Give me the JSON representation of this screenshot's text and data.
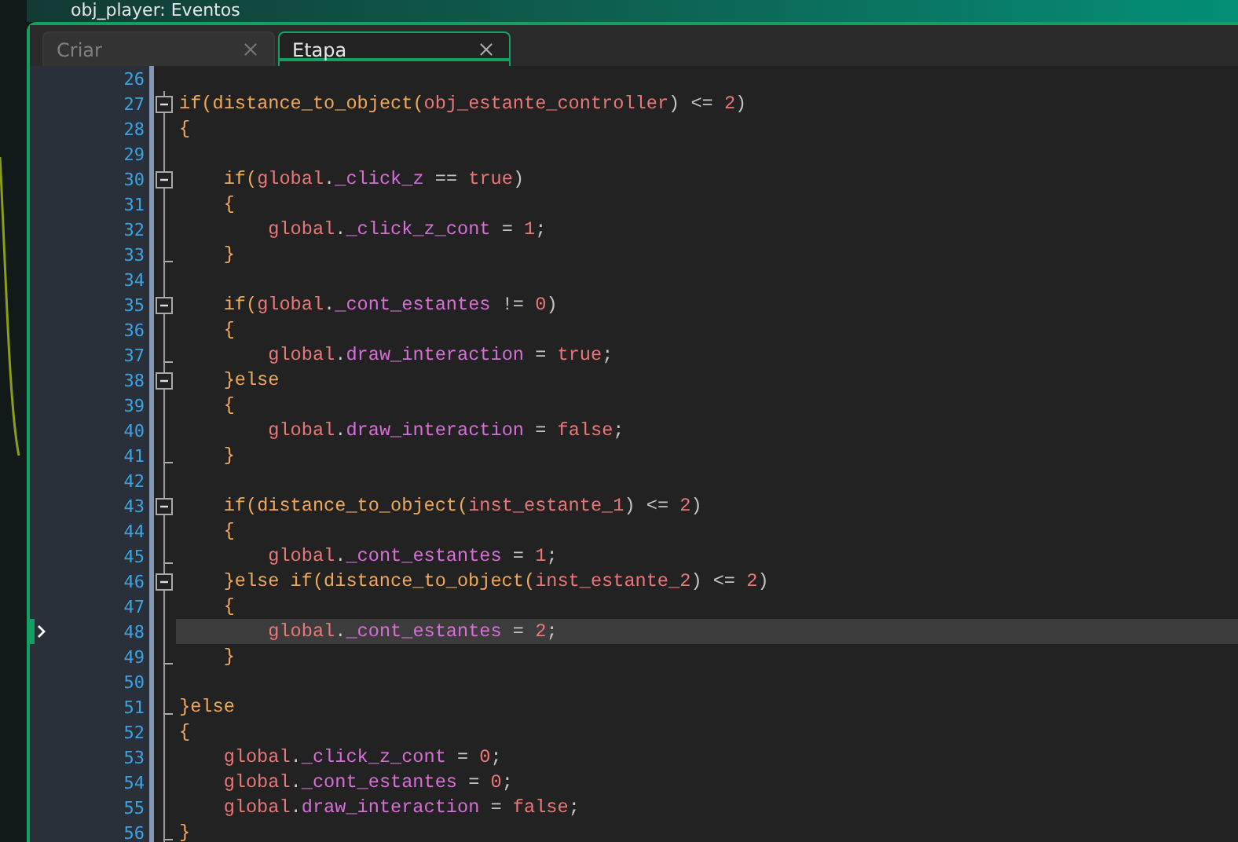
{
  "window": {
    "title": "obj_player: Eventos"
  },
  "tabs": [
    {
      "label": "Criar",
      "selected": false
    },
    {
      "label": "Etapa",
      "selected": true
    }
  ],
  "editor": {
    "lines": [
      {
        "number": "26",
        "kind": "plain",
        "current": false
      },
      {
        "number": "27",
        "kind": "fold_open",
        "current": false,
        "tokens": [
          {
            "kind": "kw",
            "text": "if("
          },
          {
            "kind": "fn",
            "text": "distance_to_object"
          },
          {
            "kind": "kw",
            "text": "("
          },
          {
            "kind": "res",
            "text": "obj_estante_controller"
          },
          {
            "kind": "op",
            "text": ") <= "
          },
          {
            "kind": "num",
            "text": "2"
          },
          {
            "kind": "op",
            "text": ")"
          }
        ]
      },
      {
        "number": "28",
        "kind": "plain",
        "current": false,
        "tokens": [
          {
            "kind": "kw",
            "text": "{"
          }
        ]
      },
      {
        "number": "29",
        "kind": "plain",
        "current": false
      },
      {
        "number": "30",
        "kind": "fold_open",
        "current": false,
        "tokens": [
          {
            "kind": "kw",
            "text": "    if("
          },
          {
            "kind": "res",
            "text": "global"
          },
          {
            "kind": "op",
            "text": "."
          },
          {
            "kind": "prop",
            "text": "_click_z"
          },
          {
            "kind": "op",
            "text": " == "
          },
          {
            "kind": "num",
            "text": "true"
          },
          {
            "kind": "op",
            "text": ")"
          }
        ]
      },
      {
        "number": "31",
        "kind": "plain",
        "current": false,
        "tokens": [
          {
            "kind": "kw",
            "text": "    {"
          }
        ]
      },
      {
        "number": "32",
        "kind": "plain",
        "current": false,
        "tokens": [
          {
            "kind": "res",
            "text": "        global"
          },
          {
            "kind": "op",
            "text": "."
          },
          {
            "kind": "prop",
            "text": "_click_z_cont"
          },
          {
            "kind": "op",
            "text": " = "
          },
          {
            "kind": "num",
            "text": "1"
          },
          {
            "kind": "op",
            "text": ";"
          }
        ]
      },
      {
        "number": "33",
        "kind": "fold_end",
        "current": false,
        "tokens": [
          {
            "kind": "kw",
            "text": "    }"
          }
        ]
      },
      {
        "number": "34",
        "kind": "plain",
        "current": false
      },
      {
        "number": "35",
        "kind": "fold_open",
        "current": false,
        "tokens": [
          {
            "kind": "kw",
            "text": "    if("
          },
          {
            "kind": "res",
            "text": "global"
          },
          {
            "kind": "op",
            "text": "."
          },
          {
            "kind": "prop",
            "text": "_cont_estantes"
          },
          {
            "kind": "op",
            "text": " != "
          },
          {
            "kind": "num",
            "text": "0"
          },
          {
            "kind": "op",
            "text": ")"
          }
        ]
      },
      {
        "number": "36",
        "kind": "plain",
        "current": false,
        "tokens": [
          {
            "kind": "kw",
            "text": "    {"
          }
        ]
      },
      {
        "number": "37",
        "kind": "fold_end",
        "current": false,
        "tokens": [
          {
            "kind": "res",
            "text": "        global"
          },
          {
            "kind": "op",
            "text": "."
          },
          {
            "kind": "prop",
            "text": "draw_interaction"
          },
          {
            "kind": "op",
            "text": " = "
          },
          {
            "kind": "num",
            "text": "true"
          },
          {
            "kind": "op",
            "text": ";"
          }
        ]
      },
      {
        "number": "38",
        "kind": "fold_open",
        "current": false,
        "tokens": [
          {
            "kind": "kw",
            "text": "    }else"
          }
        ]
      },
      {
        "number": "39",
        "kind": "plain",
        "current": false,
        "tokens": [
          {
            "kind": "kw",
            "text": "    {"
          }
        ]
      },
      {
        "number": "40",
        "kind": "plain",
        "current": false,
        "tokens": [
          {
            "kind": "res",
            "text": "        global"
          },
          {
            "kind": "op",
            "text": "."
          },
          {
            "kind": "prop",
            "text": "draw_interaction"
          },
          {
            "kind": "op",
            "text": " = "
          },
          {
            "kind": "num",
            "text": "false"
          },
          {
            "kind": "op",
            "text": ";"
          }
        ]
      },
      {
        "number": "41",
        "kind": "fold_end",
        "current": false,
        "tokens": [
          {
            "kind": "kw",
            "text": "    }"
          }
        ]
      },
      {
        "number": "42",
        "kind": "plain",
        "current": false
      },
      {
        "number": "43",
        "kind": "fold_open",
        "current": false,
        "tokens": [
          {
            "kind": "kw",
            "text": "    if("
          },
          {
            "kind": "fn",
            "text": "distance_to_object"
          },
          {
            "kind": "kw",
            "text": "("
          },
          {
            "kind": "res",
            "text": "inst_estante_1"
          },
          {
            "kind": "op",
            "text": ") <= "
          },
          {
            "kind": "num",
            "text": "2"
          },
          {
            "kind": "op",
            "text": ")"
          }
        ]
      },
      {
        "number": "44",
        "kind": "plain",
        "current": false,
        "tokens": [
          {
            "kind": "kw",
            "text": "    {"
          }
        ]
      },
      {
        "number": "45",
        "kind": "fold_end",
        "current": false,
        "tokens": [
          {
            "kind": "res",
            "text": "        global"
          },
          {
            "kind": "op",
            "text": "."
          },
          {
            "kind": "prop",
            "text": "_cont_estantes"
          },
          {
            "kind": "op",
            "text": " = "
          },
          {
            "kind": "num",
            "text": "1"
          },
          {
            "kind": "op",
            "text": ";"
          }
        ]
      },
      {
        "number": "46",
        "kind": "fold_open",
        "current": false,
        "tokens": [
          {
            "kind": "kw",
            "text": "    }else if("
          },
          {
            "kind": "fn",
            "text": "distance_to_object"
          },
          {
            "kind": "kw",
            "text": "("
          },
          {
            "kind": "res",
            "text": "inst_estante_2"
          },
          {
            "kind": "op",
            "text": ") <= "
          },
          {
            "kind": "num",
            "text": "2"
          },
          {
            "kind": "op",
            "text": ")"
          }
        ]
      },
      {
        "number": "47",
        "kind": "plain",
        "current": false,
        "tokens": [
          {
            "kind": "kw",
            "text": "    {"
          }
        ]
      },
      {
        "number": "48",
        "kind": "plain",
        "current": true,
        "tokens": [
          {
            "kind": "res",
            "text": "        global"
          },
          {
            "kind": "op",
            "text": "."
          },
          {
            "kind": "prop",
            "text": "_cont_estantes"
          },
          {
            "kind": "op",
            "text": " = "
          },
          {
            "kind": "num",
            "text": "2"
          },
          {
            "kind": "op",
            "text": ";"
          }
        ]
      },
      {
        "number": "49",
        "kind": "fold_end",
        "current": false,
        "tokens": [
          {
            "kind": "kw",
            "text": "    }"
          }
        ]
      },
      {
        "number": "50",
        "kind": "plain",
        "current": false
      },
      {
        "number": "51",
        "kind": "fold_end",
        "current": false,
        "tokens": [
          {
            "kind": "kw",
            "text": "}else"
          }
        ]
      },
      {
        "number": "52",
        "kind": "plain",
        "current": false,
        "tokens": [
          {
            "kind": "kw",
            "text": "{"
          }
        ]
      },
      {
        "number": "53",
        "kind": "plain",
        "current": false,
        "tokens": [
          {
            "kind": "res",
            "text": "    global"
          },
          {
            "kind": "op",
            "text": "."
          },
          {
            "kind": "prop",
            "text": "_click_z_cont"
          },
          {
            "kind": "op",
            "text": " = "
          },
          {
            "kind": "num",
            "text": "0"
          },
          {
            "kind": "op",
            "text": ";"
          }
        ]
      },
      {
        "number": "54",
        "kind": "plain",
        "current": false,
        "tokens": [
          {
            "kind": "res",
            "text": "    global"
          },
          {
            "kind": "op",
            "text": "."
          },
          {
            "kind": "prop",
            "text": "_cont_estantes"
          },
          {
            "kind": "op",
            "text": " = "
          },
          {
            "kind": "num",
            "text": "0"
          },
          {
            "kind": "op",
            "text": ";"
          }
        ]
      },
      {
        "number": "55",
        "kind": "plain",
        "current": false,
        "tokens": [
          {
            "kind": "res",
            "text": "    global"
          },
          {
            "kind": "op",
            "text": "."
          },
          {
            "kind": "prop",
            "text": "draw_interaction"
          },
          {
            "kind": "op",
            "text": " = "
          },
          {
            "kind": "num",
            "text": "false"
          },
          {
            "kind": "op",
            "text": ";"
          }
        ]
      },
      {
        "number": "56",
        "kind": "fold_end",
        "current": false,
        "tokens": [
          {
            "kind": "kw",
            "text": "}"
          }
        ]
      }
    ]
  }
}
